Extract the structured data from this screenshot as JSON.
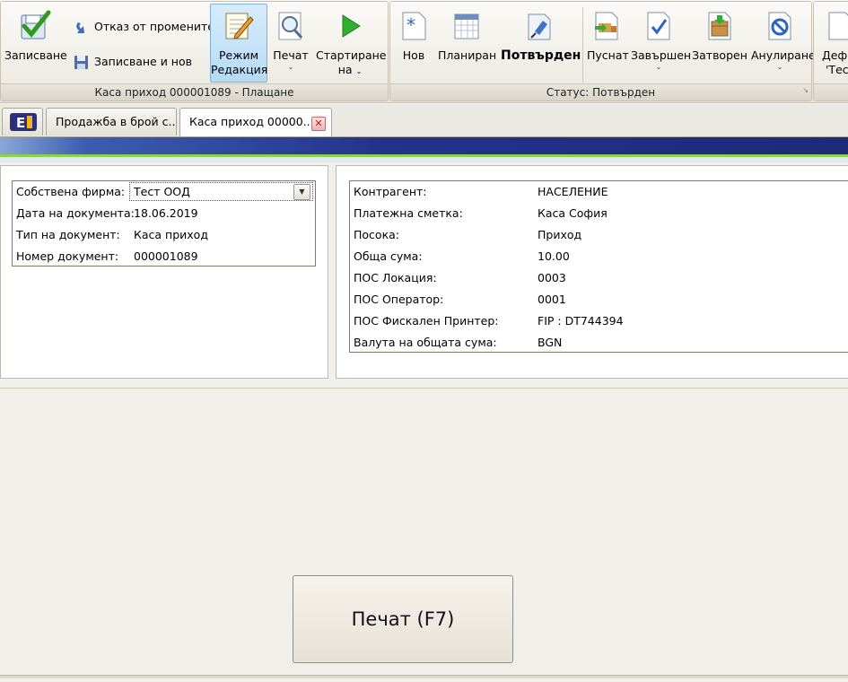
{
  "ribbon": {
    "save": "Записване",
    "undo_changes": "Отказ от промените",
    "save_and_new": "Записване и нов",
    "edit_mode_line1": "Режим",
    "edit_mode_line2": "Редакция",
    "print": "Печат",
    "start_on_line1": "Стартиране",
    "start_on_line2": "на",
    "group1_label": "Каса приход 000001089 - Плащане",
    "new": "Нов",
    "planned": "Планиран",
    "confirmed": "Потвърден",
    "released": "Пуснат",
    "completed": "Завършен",
    "closed": "Затворен",
    "cancel": "Анулиране",
    "status_label": "Статус: Потвърден",
    "define_line1": "Дефи",
    "define_line2": "'Тес"
  },
  "tabs": [
    {
      "label": "Продажба в брой с..."
    },
    {
      "label": "Каса приход 00000..."
    }
  ],
  "left_fields": [
    {
      "label": "Собствена фирма:",
      "value": "Тест ООД"
    },
    {
      "label": "Дата на документа:",
      "value": "18.06.2019"
    },
    {
      "label": "Тип на документ:",
      "value": "Каса приход"
    },
    {
      "label": "Номер документ:",
      "value": "000001089"
    }
  ],
  "right_fields": [
    {
      "label": "Контрагент:",
      "value": "НАСЕЛЕНИЕ"
    },
    {
      "label": "Платежна сметка:",
      "value": "Каса София"
    },
    {
      "label": "Посока:",
      "value": "Приход"
    },
    {
      "label": "Обща сума:",
      "value": "10.00"
    },
    {
      "label": "ПОС Локация:",
      "value": "0003"
    },
    {
      "label": "ПОС Оператор:",
      "value": "0001"
    },
    {
      "label": "ПОС Фискален Принтер:",
      "value": "FIP : DT744394"
    },
    {
      "label": "Валута на общата сума:",
      "value": "BGN"
    }
  ],
  "print_button": "Печат (F7)",
  "colors": {
    "banner_dark": "#1d2a7a",
    "banner_green": "#8fd14f",
    "active_button": "#b6dbf6",
    "close_red": "#b81f1f"
  }
}
